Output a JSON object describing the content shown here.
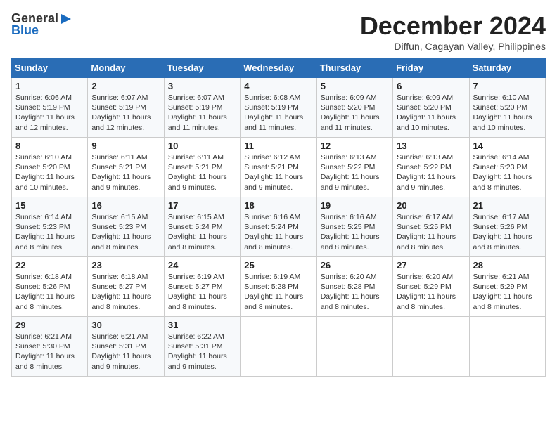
{
  "logo": {
    "line1": "General",
    "line2": "Blue"
  },
  "title": "December 2024",
  "subtitle": "Diffun, Cagayan Valley, Philippines",
  "weekdays": [
    "Sunday",
    "Monday",
    "Tuesday",
    "Wednesday",
    "Thursday",
    "Friday",
    "Saturday"
  ],
  "weeks": [
    [
      {
        "day": "1",
        "info": "Sunrise: 6:06 AM\nSunset: 5:19 PM\nDaylight: 11 hours\nand 12 minutes."
      },
      {
        "day": "2",
        "info": "Sunrise: 6:07 AM\nSunset: 5:19 PM\nDaylight: 11 hours\nand 12 minutes."
      },
      {
        "day": "3",
        "info": "Sunrise: 6:07 AM\nSunset: 5:19 PM\nDaylight: 11 hours\nand 11 minutes."
      },
      {
        "day": "4",
        "info": "Sunrise: 6:08 AM\nSunset: 5:19 PM\nDaylight: 11 hours\nand 11 minutes."
      },
      {
        "day": "5",
        "info": "Sunrise: 6:09 AM\nSunset: 5:20 PM\nDaylight: 11 hours\nand 11 minutes."
      },
      {
        "day": "6",
        "info": "Sunrise: 6:09 AM\nSunset: 5:20 PM\nDaylight: 11 hours\nand 10 minutes."
      },
      {
        "day": "7",
        "info": "Sunrise: 6:10 AM\nSunset: 5:20 PM\nDaylight: 11 hours\nand 10 minutes."
      }
    ],
    [
      {
        "day": "8",
        "info": "Sunrise: 6:10 AM\nSunset: 5:20 PM\nDaylight: 11 hours\nand 10 minutes."
      },
      {
        "day": "9",
        "info": "Sunrise: 6:11 AM\nSunset: 5:21 PM\nDaylight: 11 hours\nand 9 minutes."
      },
      {
        "day": "10",
        "info": "Sunrise: 6:11 AM\nSunset: 5:21 PM\nDaylight: 11 hours\nand 9 minutes."
      },
      {
        "day": "11",
        "info": "Sunrise: 6:12 AM\nSunset: 5:21 PM\nDaylight: 11 hours\nand 9 minutes."
      },
      {
        "day": "12",
        "info": "Sunrise: 6:13 AM\nSunset: 5:22 PM\nDaylight: 11 hours\nand 9 minutes."
      },
      {
        "day": "13",
        "info": "Sunrise: 6:13 AM\nSunset: 5:22 PM\nDaylight: 11 hours\nand 9 minutes."
      },
      {
        "day": "14",
        "info": "Sunrise: 6:14 AM\nSunset: 5:23 PM\nDaylight: 11 hours\nand 8 minutes."
      }
    ],
    [
      {
        "day": "15",
        "info": "Sunrise: 6:14 AM\nSunset: 5:23 PM\nDaylight: 11 hours\nand 8 minutes."
      },
      {
        "day": "16",
        "info": "Sunrise: 6:15 AM\nSunset: 5:23 PM\nDaylight: 11 hours\nand 8 minutes."
      },
      {
        "day": "17",
        "info": "Sunrise: 6:15 AM\nSunset: 5:24 PM\nDaylight: 11 hours\nand 8 minutes."
      },
      {
        "day": "18",
        "info": "Sunrise: 6:16 AM\nSunset: 5:24 PM\nDaylight: 11 hours\nand 8 minutes."
      },
      {
        "day": "19",
        "info": "Sunrise: 6:16 AM\nSunset: 5:25 PM\nDaylight: 11 hours\nand 8 minutes."
      },
      {
        "day": "20",
        "info": "Sunrise: 6:17 AM\nSunset: 5:25 PM\nDaylight: 11 hours\nand 8 minutes."
      },
      {
        "day": "21",
        "info": "Sunrise: 6:17 AM\nSunset: 5:26 PM\nDaylight: 11 hours\nand 8 minutes."
      }
    ],
    [
      {
        "day": "22",
        "info": "Sunrise: 6:18 AM\nSunset: 5:26 PM\nDaylight: 11 hours\nand 8 minutes."
      },
      {
        "day": "23",
        "info": "Sunrise: 6:18 AM\nSunset: 5:27 PM\nDaylight: 11 hours\nand 8 minutes."
      },
      {
        "day": "24",
        "info": "Sunrise: 6:19 AM\nSunset: 5:27 PM\nDaylight: 11 hours\nand 8 minutes."
      },
      {
        "day": "25",
        "info": "Sunrise: 6:19 AM\nSunset: 5:28 PM\nDaylight: 11 hours\nand 8 minutes."
      },
      {
        "day": "26",
        "info": "Sunrise: 6:20 AM\nSunset: 5:28 PM\nDaylight: 11 hours\nand 8 minutes."
      },
      {
        "day": "27",
        "info": "Sunrise: 6:20 AM\nSunset: 5:29 PM\nDaylight: 11 hours\nand 8 minutes."
      },
      {
        "day": "28",
        "info": "Sunrise: 6:21 AM\nSunset: 5:29 PM\nDaylight: 11 hours\nand 8 minutes."
      }
    ],
    [
      {
        "day": "29",
        "info": "Sunrise: 6:21 AM\nSunset: 5:30 PM\nDaylight: 11 hours\nand 8 minutes."
      },
      {
        "day": "30",
        "info": "Sunrise: 6:21 AM\nSunset: 5:31 PM\nDaylight: 11 hours\nand 9 minutes."
      },
      {
        "day": "31",
        "info": "Sunrise: 6:22 AM\nSunset: 5:31 PM\nDaylight: 11 hours\nand 9 minutes."
      },
      {
        "day": "",
        "info": ""
      },
      {
        "day": "",
        "info": ""
      },
      {
        "day": "",
        "info": ""
      },
      {
        "day": "",
        "info": ""
      }
    ]
  ]
}
